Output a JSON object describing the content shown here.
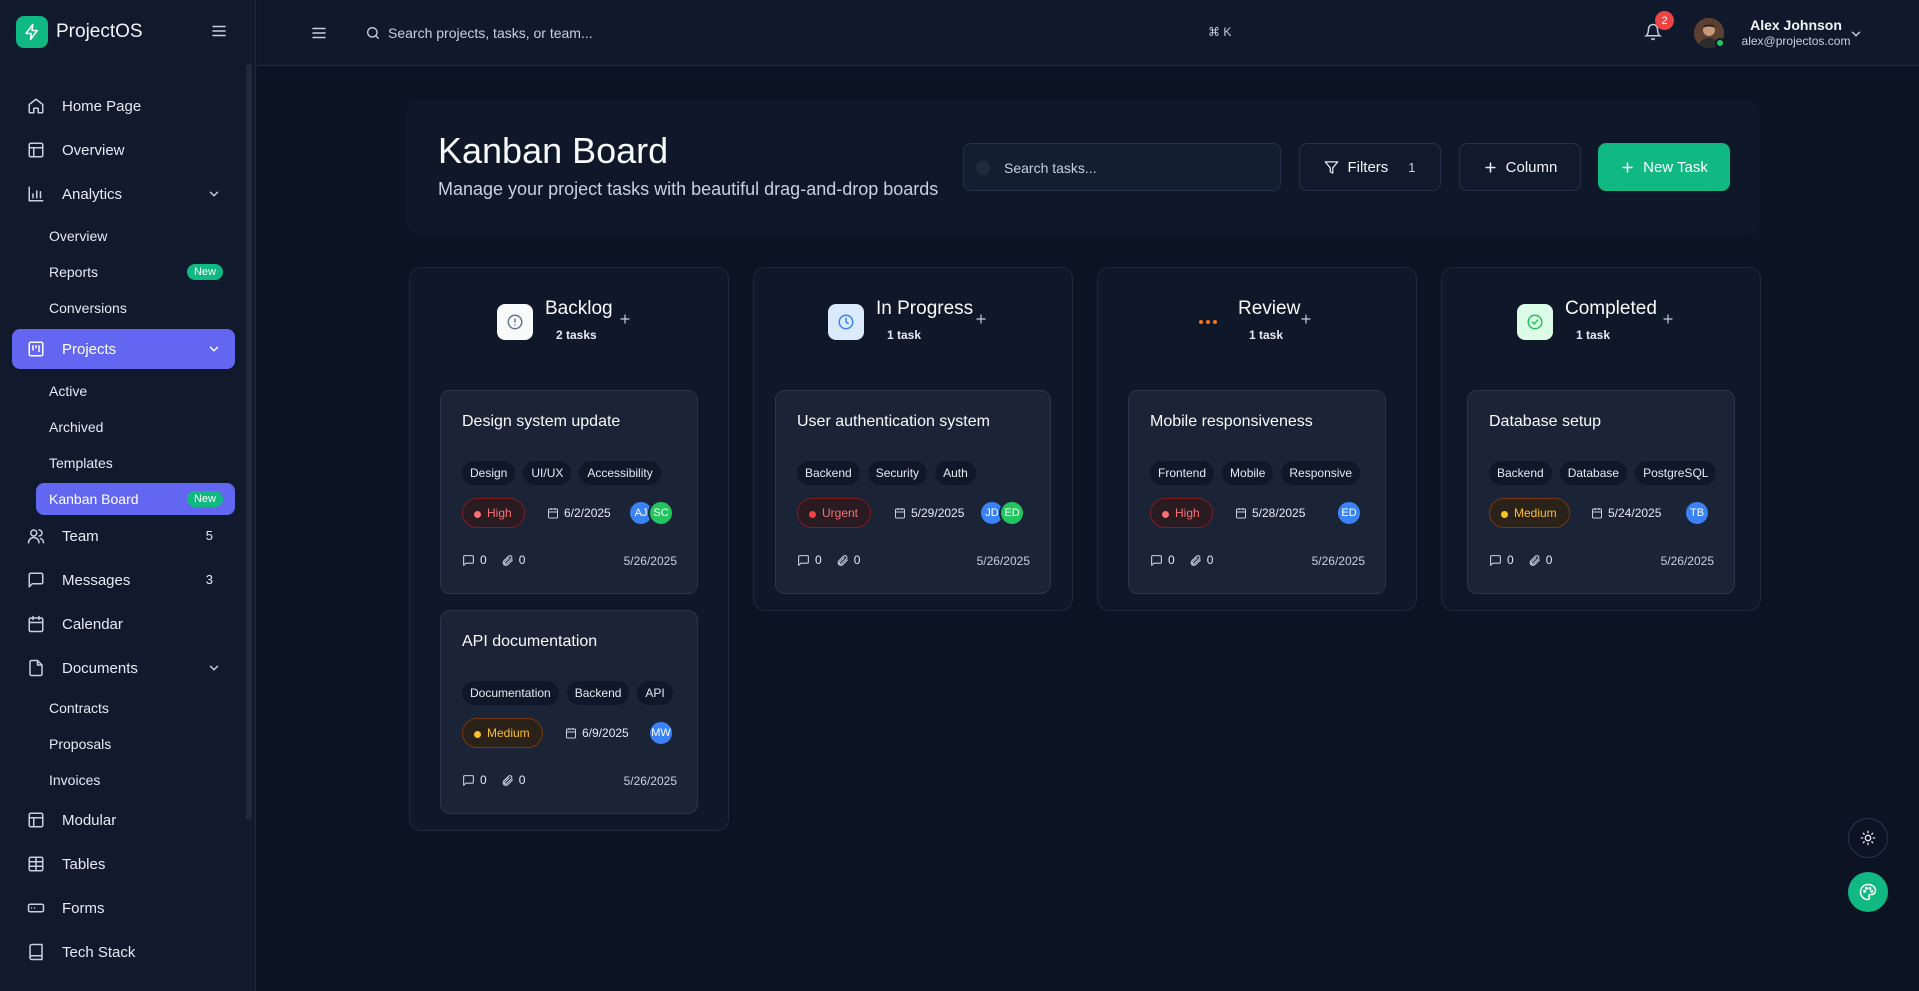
{
  "app": {
    "name": "ProjectOS"
  },
  "sidebar": {
    "items": [
      {
        "label": "Home Page"
      },
      {
        "label": "Overview"
      },
      {
        "label": "Analytics"
      },
      {
        "label": "Projects"
      },
      {
        "label": "Team",
        "count": "5"
      },
      {
        "label": "Messages",
        "count": "3"
      },
      {
        "label": "Calendar"
      },
      {
        "label": "Documents"
      },
      {
        "label": "Modular"
      },
      {
        "label": "Tables"
      },
      {
        "label": "Forms"
      },
      {
        "label": "Tech Stack"
      }
    ],
    "analytics_sub": [
      {
        "label": "Overview"
      },
      {
        "label": "Reports",
        "badge": "New"
      },
      {
        "label": "Conversions"
      }
    ],
    "projects_sub": [
      {
        "label": "Active"
      },
      {
        "label": "Archived"
      },
      {
        "label": "Templates"
      },
      {
        "label": "Kanban Board",
        "badge": "New"
      }
    ],
    "documents_sub": [
      {
        "label": "Contracts"
      },
      {
        "label": "Proposals"
      },
      {
        "label": "Invoices"
      }
    ]
  },
  "topbar": {
    "search_placeholder": "Search projects, tasks, or team...",
    "shortcut": "⌘ K",
    "notification_count": "2",
    "user_name": "Alex Johnson",
    "user_email": "alex@projectos.com"
  },
  "page": {
    "title": "Kanban Board",
    "subtitle": "Manage your project tasks with beautiful drag-and-drop boards",
    "search_placeholder": "Search tasks...",
    "filters_label": "Filters",
    "filters_count": "1",
    "column_label": "Column",
    "new_task_label": "New Task"
  },
  "colors": {
    "accent": "#6366f1",
    "primary": "#10b981",
    "danger": "#ef4444",
    "warning": "#f59e0b"
  },
  "columns": [
    {
      "title": "Backlog",
      "count": "2 tasks",
      "icon": "alert-circle-icon",
      "cards": [
        {
          "title": "Design system update",
          "tags": [
            "Design",
            "UI/UX",
            "Accessibility"
          ],
          "priority": "High",
          "due": "6/2/2025",
          "assignees": [
            "AJ",
            "SC"
          ],
          "comments": "0",
          "attachments": "0",
          "created": "5/26/2025"
        },
        {
          "title": "API documentation",
          "tags": [
            "Documentation",
            "Backend",
            "API"
          ],
          "priority": "Medium",
          "due": "6/9/2025",
          "assignees": [
            "MW"
          ],
          "comments": "0",
          "attachments": "0",
          "created": "5/26/2025"
        }
      ]
    },
    {
      "title": "In Progress",
      "count": "1 task",
      "icon": "clock-icon",
      "cards": [
        {
          "title": "User authentication system",
          "tags": [
            "Backend",
            "Security",
            "Auth"
          ],
          "priority": "Urgent",
          "due": "5/29/2025",
          "assignees": [
            "JD",
            "ED"
          ],
          "comments": "0",
          "attachments": "0",
          "created": "5/26/2025"
        }
      ]
    },
    {
      "title": "Review",
      "count": "1 task",
      "icon": "more-horizontal-icon",
      "cards": [
        {
          "title": "Mobile responsiveness",
          "tags": [
            "Frontend",
            "Mobile",
            "Responsive"
          ],
          "priority": "High",
          "due": "5/28/2025",
          "assignees": [
            "ED"
          ],
          "comments": "0",
          "attachments": "0",
          "created": "5/26/2025"
        }
      ]
    },
    {
      "title": "Completed",
      "count": "1 task",
      "icon": "check-circle-icon",
      "cards": [
        {
          "title": "Database setup",
          "tags": [
            "Backend",
            "Database",
            "PostgreSQL"
          ],
          "priority": "Medium",
          "due": "5/24/2025",
          "assignees": [
            "TB"
          ],
          "comments": "0",
          "attachments": "0",
          "created": "5/26/2025"
        }
      ]
    }
  ]
}
